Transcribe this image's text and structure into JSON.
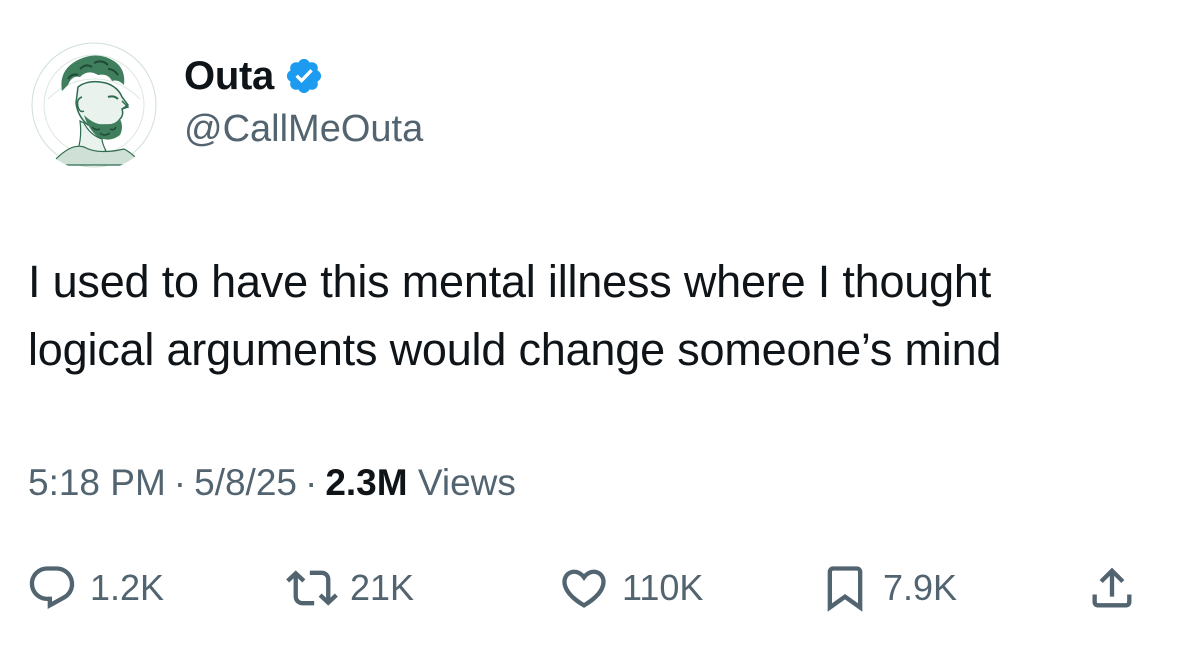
{
  "author": {
    "display_name": "Outa",
    "handle": "@CallMeOuta",
    "verified": true,
    "avatar_icon": "classical-bust-portrait",
    "avatar_color": "#2f6b4f",
    "verified_color": "#1d9bf0"
  },
  "tweet": {
    "text_lines": [
      "I used to have this mental illness where I thought",
      "logical arguments would change someone’s mind"
    ]
  },
  "meta": {
    "time": "5:18 PM",
    "date": "5/8/25",
    "separator": "·",
    "views_count": "2.3M",
    "views_label": "Views"
  },
  "actions": {
    "reply": {
      "icon": "reply-icon",
      "count": "1.2K"
    },
    "retweet": {
      "icon": "retweet-icon",
      "count": "21K"
    },
    "like": {
      "icon": "heart-icon",
      "count": "110K"
    },
    "bookmark": {
      "icon": "bookmark-icon",
      "count": "7.9K"
    },
    "share": {
      "icon": "share-icon"
    }
  },
  "colors": {
    "text_primary": "#0f1419",
    "text_secondary": "#536471"
  }
}
